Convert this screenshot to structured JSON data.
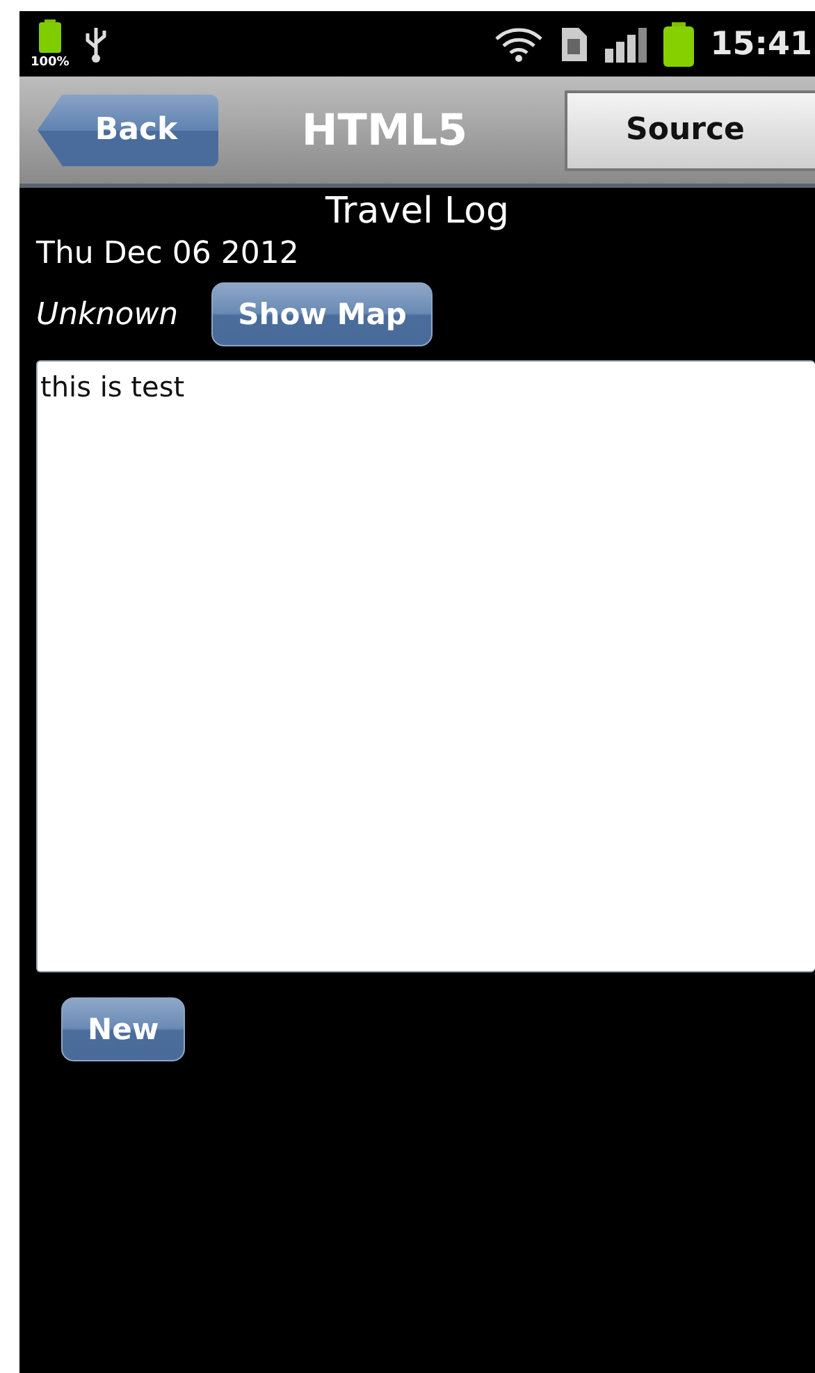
{
  "status_bar": {
    "battery_percent": "100%",
    "time": "15:41"
  },
  "header": {
    "back": "Back",
    "title": "HTML5",
    "source": "Source"
  },
  "page": {
    "title": "Travel Log",
    "date": "Thu Dec 06 2012",
    "location": "Unknown",
    "show_map": "Show Map",
    "note": "this is test",
    "new_button": "New"
  }
}
